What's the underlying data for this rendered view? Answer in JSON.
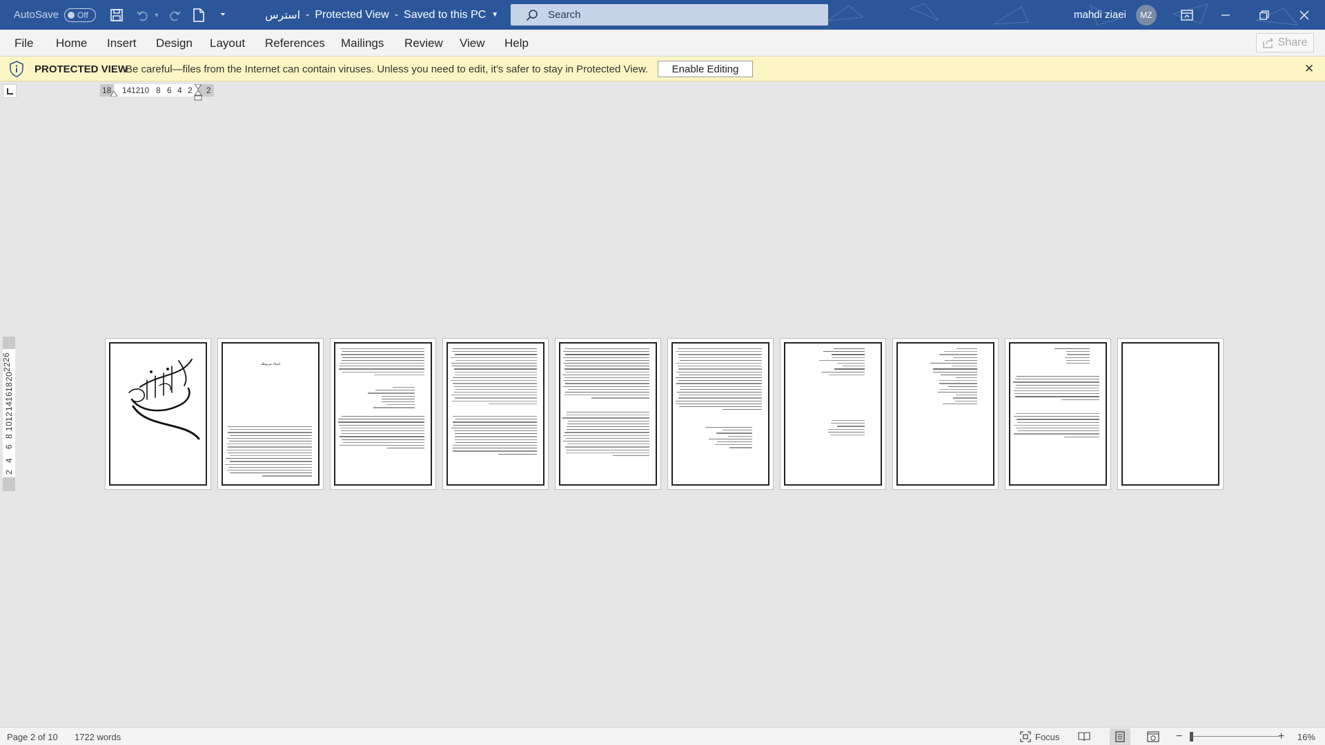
{
  "titlebar": {
    "autosave_label": "AutoSave",
    "autosave_state": "Off",
    "doc_name": "استرس",
    "view_mode": "Protected View",
    "save_status": "Saved to this PC",
    "search_placeholder": "Search",
    "user_name": "mahdi ziaei",
    "user_initials": "MZ",
    "bg_color": "#2b579a"
  },
  "ribbon": {
    "tabs": [
      "File",
      "Home",
      "Insert",
      "Design",
      "Layout",
      "References",
      "Mailings",
      "Review",
      "View",
      "Help"
    ],
    "share_label": "Share"
  },
  "protected_view": {
    "title": "PROTECTED VIEW",
    "message": "Be careful—files from the Internet can contain viruses. Unless you need to edit, it's safer to stay in Protected View.",
    "enable_button": "Enable Editing",
    "bg_color": "#fdf6c4"
  },
  "ruler": {
    "horizontal_labels": [
      "18",
      "14",
      "12",
      "10",
      "8",
      "6",
      "4",
      "2",
      "2"
    ],
    "vertical_labels": [
      "2",
      "4",
      "6",
      "8",
      "10",
      "12",
      "14",
      "16",
      "18",
      "20",
      "22",
      "26"
    ]
  },
  "document": {
    "page_count": 10,
    "page2_heading": "اسناد مربوطه"
  },
  "statusbar": {
    "page_info": "Page 2 of 10",
    "word_count": "1722 words",
    "focus_label": "Focus",
    "zoom_level": "16%"
  }
}
